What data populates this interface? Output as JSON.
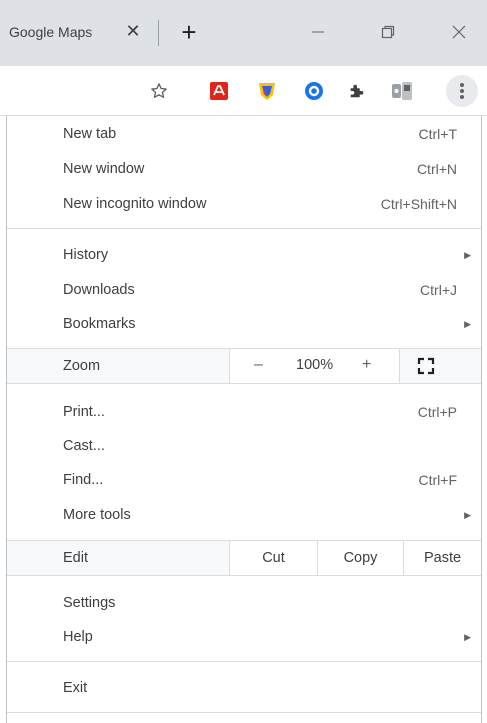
{
  "tab": {
    "title": "Google Maps",
    "close_glyph": "✕",
    "new_tab_glyph": "+"
  },
  "window": {
    "minimize_glyph": "—",
    "restore_glyph": "⧉",
    "close_glyph": "✕"
  },
  "toolbar": {
    "bookmark_icon": "star-outline-icon",
    "extensions": [
      "acrobat-extension-icon",
      "shield-extension-icon",
      "blue-o-extension-icon",
      "puzzle-extensions-icon",
      "media-extension-icon"
    ],
    "menu_icon": "kebab-menu-icon"
  },
  "menu": {
    "new_tab": {
      "label": "New tab",
      "shortcut": "Ctrl+T"
    },
    "new_window": {
      "label": "New window",
      "shortcut": "Ctrl+N"
    },
    "new_incognito": {
      "label": "New incognito window",
      "shortcut": "Ctrl+Shift+N"
    },
    "history": {
      "label": "History"
    },
    "downloads": {
      "label": "Downloads",
      "shortcut": "Ctrl+J"
    },
    "bookmarks": {
      "label": "Bookmarks"
    },
    "zoom": {
      "label": "Zoom",
      "minus": "–",
      "value": "100%",
      "plus": "+"
    },
    "print": {
      "label": "Print...",
      "shortcut": "Ctrl+P"
    },
    "cast": {
      "label": "Cast..."
    },
    "find": {
      "label": "Find...",
      "shortcut": "Ctrl+F"
    },
    "more_tools": {
      "label": "More tools"
    },
    "edit": {
      "label": "Edit",
      "cut": "Cut",
      "copy": "Copy",
      "paste": "Paste"
    },
    "settings": {
      "label": "Settings"
    },
    "help": {
      "label": "Help"
    },
    "exit": {
      "label": "Exit"
    },
    "submenu_arrow": "▶"
  },
  "colors": {
    "tabstrip": "#dee1e6",
    "menu_text": "#3c4043",
    "shortcut_text": "#5f6368",
    "separator": "#dadce0"
  }
}
